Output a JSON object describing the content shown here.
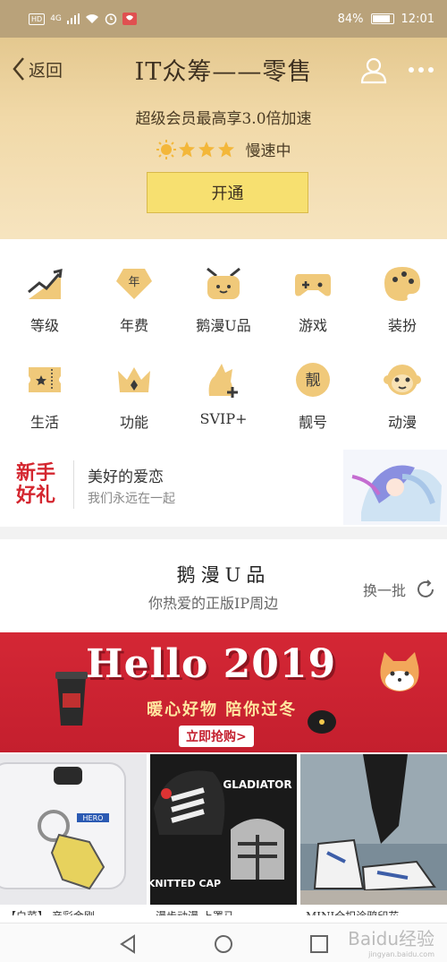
{
  "status_bar": {
    "network_badge": "HD",
    "signal": "4G",
    "battery": "84%",
    "time": "12:01"
  },
  "header": {
    "back_label": "返回",
    "title": "IT众筹——零售",
    "subtitle": "超级会员最高享3.0倍加速",
    "speed_status": "慢速中",
    "open_button": "开通"
  },
  "grid": {
    "items": [
      {
        "label": "等级",
        "icon": "level-icon"
      },
      {
        "label": "年费",
        "icon": "annual-fee-icon"
      },
      {
        "label": "鹅漫U品",
        "icon": "ego-shop-icon"
      },
      {
        "label": "游戏",
        "icon": "game-icon"
      },
      {
        "label": "装扮",
        "icon": "palette-icon"
      },
      {
        "label": "生活",
        "icon": "ticket-icon"
      },
      {
        "label": "功能",
        "icon": "crown-icon"
      },
      {
        "label": "SVIP+",
        "icon": "svip-plus-icon"
      },
      {
        "label": "靓号",
        "icon": "pretty-number-icon"
      },
      {
        "label": "动漫",
        "icon": "monkey-icon"
      }
    ],
    "annual_icon_text": "年",
    "pretty_icon_text": "靓"
  },
  "promo": {
    "logo_line1": "新手",
    "logo_line2": "好礼",
    "title": "美好的爱恋",
    "subtitle": "我们永远在一起"
  },
  "section": {
    "title": "鹅漫U品",
    "subtitle": "你热爱的正版IP周边",
    "refresh_label": "换一批"
  },
  "banner": {
    "headline": "Hello 2019",
    "tagline": "暖心好物 陪你过冬",
    "cta": "立即抢购>"
  },
  "products": [
    {
      "caption": "【白菜】 产彩金刚"
    },
    {
      "caption": "漫步动漫 上罩马"
    },
    {
      "caption": "MINI全扣涂鸦印花"
    }
  ],
  "product_art_text": {
    "hero": "HERO",
    "gladiator": "GLADIATOR",
    "knitted": "KNITTED CAP"
  },
  "watermark": {
    "brand": "Baidu经验",
    "url": "jingyan.baidu.com"
  },
  "colors": {
    "header_gold": "#e4c88f",
    "button_yellow": "#f7e070",
    "banner_red": "#c41f2e",
    "icon_gold": "#e8b85c"
  }
}
